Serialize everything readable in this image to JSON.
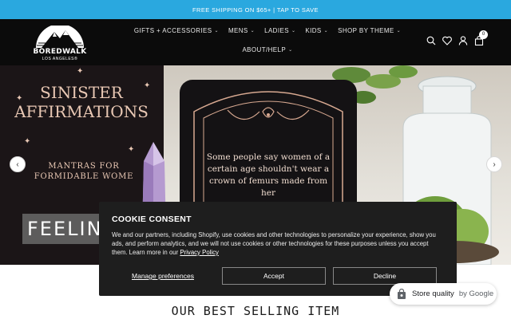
{
  "announcement": {
    "text": "FREE SHIPPING ON $65+ | TAP TO SAVE"
  },
  "logo": {
    "brand": "BOREDWALK",
    "sub": "LOS ANGELES®"
  },
  "nav": {
    "row1": [
      {
        "label": "GIFTS + ACCESSORIES"
      },
      {
        "label": "MENS"
      },
      {
        "label": "LADIES"
      },
      {
        "label": "KIDS"
      },
      {
        "label": "SHOP BY THEME"
      }
    ],
    "row2": [
      {
        "label": "ABOUT/HELP"
      }
    ]
  },
  "header_icons": [
    "search-icon",
    "heart-icon",
    "account-icon",
    "cart-icon"
  ],
  "cart": {
    "count": "0"
  },
  "hero": {
    "book_title": "SINISTER AFFIRMATIONS",
    "book_subtitle": "MANTRAS FOR FORMIDABLE WOME",
    "card_text": "Some people say women of a certain age shouldn't wear a crown of femurs made from her",
    "banner_text": "FEELING",
    "prev_icon": "chevron-left-icon",
    "next_icon": "chevron-right-icon"
  },
  "cookie": {
    "title": "COOKIE CONSENT",
    "body": "We and our partners, including Shopify, use cookies and other technologies to personalize your experience, show you ads, and perform analytics, and we will not use cookies or other technologies for these purposes unless you accept them. Learn more in our",
    "policy_link": "Privacy Policy",
    "manage_label": "Manage preferences",
    "accept_label": "Accept",
    "decline_label": "Decline"
  },
  "section": {
    "title": "OUR BEST SELLING ITEM"
  },
  "store_quality": {
    "label": "Store quality",
    "by": "by Google"
  },
  "colors": {
    "announcement_bg": "#2aa8df",
    "header_bg": "#0b0b0b",
    "cookie_bg": "#1e1e1e"
  }
}
